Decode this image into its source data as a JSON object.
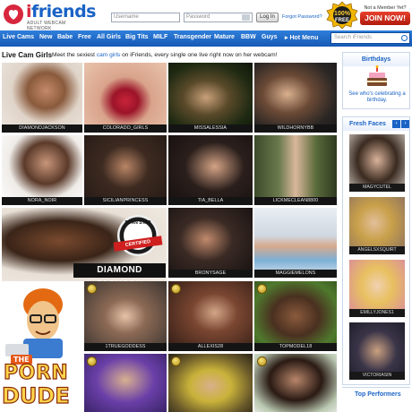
{
  "header": {
    "logo_text": "iFriends",
    "logo_i": "i",
    "logo_rest": "friends",
    "tagline": "ADULT WEBCAM NETWORK",
    "username_placeholder": "Username",
    "password_placeholder": "Password",
    "login_label": "Log In",
    "forgot_label": "Forgot Password?",
    "free_badge": "100% FREE",
    "not_member": "Not a Member Yet?",
    "join_label": "JOIN NOW!"
  },
  "nav": {
    "items": [
      "Live Cams",
      "New",
      "Babe",
      "Free",
      "All Girls",
      "Big Tits",
      "MILF",
      "Transgender",
      "Mature",
      "BBW",
      "Guys",
      "▸ Hot Menu"
    ],
    "search_placeholder": "Search iFriends"
  },
  "section": {
    "title": "Live Cam Girls",
    "sub_before": "Meet the sexiest ",
    "sub_link": "cam girls",
    "sub_after": " on iFriends, every single one live right now on her webcam!"
  },
  "grid": {
    "row1": [
      "DIAMONDJACKSON",
      "COLORADO_GIRLS",
      "MISSALESSIA",
      "WILDHORNYBB"
    ],
    "row2": [
      "NORA_NOIR",
      "SICILIANPRINCESS",
      "TIA_BELLA",
      "LICKMECLEAN8800"
    ],
    "row3": [
      "BRONYSAGE",
      "MAGGIEMELONS"
    ],
    "row4": [
      "1TRUEGODDESS",
      "ALLEXIS28",
      "TOPMODEL18"
    ]
  },
  "featured": {
    "name": "DIAMOND JACKSON",
    "seal_top": "PORN STAR",
    "seal_label": "CERTIFIED"
  },
  "porn_dude": {
    "the": "THE",
    "porn": "PORN",
    "dude": "DUDE"
  },
  "sidebar": {
    "birthdays_title": "Birthdays",
    "birthdays_text": "See who's celebrating a birthday.",
    "fresh_title": "Fresh Faces",
    "fresh": [
      "MAGYCUTEL",
      "ANGELSXSQUIRT",
      "EMILLYJONES1",
      "VICTORIASIN"
    ],
    "top_title": "Top Performers"
  },
  "colors": {
    "brand": "#1a63c6",
    "nav": "#1659b5",
    "join": "#d32a17"
  }
}
